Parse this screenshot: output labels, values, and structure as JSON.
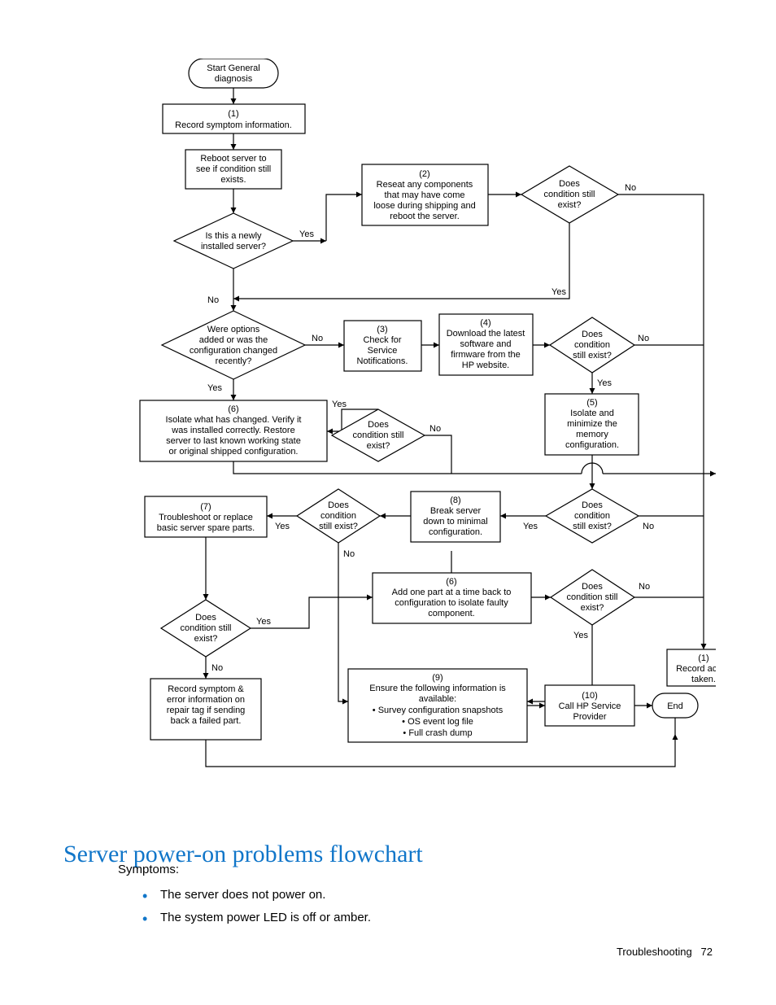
{
  "heading": "Server power-on problems flowchart",
  "body": {
    "intro": "Symptoms:",
    "bullets": [
      "The server does not power on.",
      "The system power LED is off or amber."
    ]
  },
  "footer": {
    "section": "Troubleshooting",
    "page": "72"
  },
  "flow": {
    "start": {
      "l1": "Start General",
      "l2": "diagnosis"
    },
    "n1": {
      "num": "(1)",
      "l1": "Record symptom information."
    },
    "reboot": {
      "l1": "Reboot server to",
      "l2": "see if condition still",
      "l3": "exists."
    },
    "d_newly": {
      "l1": "Is this a newly",
      "l2": "installed server?"
    },
    "n2": {
      "num": "(2)",
      "l1": "Reseat any components",
      "l2": "that may have come",
      "l3": "loose during shipping and",
      "l4": "reboot the server."
    },
    "d_cond_top": {
      "l1": "Does",
      "l2": "condition still",
      "l3": "exist?"
    },
    "d_options": {
      "l1": "Were options",
      "l2": "added or was the",
      "l3": "configuration changed",
      "l4": "recently?"
    },
    "n3": {
      "num": "(3)",
      "l1": "Check for",
      "l2": "Service",
      "l3": "Notifications."
    },
    "n4": {
      "num": "(4)",
      "l1": "Download the latest",
      "l2": "software and",
      "l3": "firmware from the",
      "l4": "HP website."
    },
    "d_cond_mid": {
      "l1": "Does",
      "l2": "condition",
      "l3": "still exist?"
    },
    "n5": {
      "num": "(5)",
      "l1": "Isolate and",
      "l2": "minimize the",
      "l3": "memory",
      "l4": "configuration."
    },
    "n6": {
      "num": "(6)",
      "l1": "Isolate what has changed. Verify it",
      "l2": "was installed correctly.  Restore",
      "l3": "server to last known working state",
      "l4": "or original shipped configuration."
    },
    "d_cond_mid2": {
      "l1": "Does",
      "l2": "condition still",
      "l3": "exist?"
    },
    "n7": {
      "num": "(7)",
      "l1": "Troubleshoot or replace",
      "l2": "basic server spare parts."
    },
    "d_cond_7": {
      "l1": "Does",
      "l2": "condition",
      "l3": "still exist?"
    },
    "n8": {
      "num": "(8)",
      "l1": "Break server",
      "l2": "down to minimal",
      "l3": "configuration."
    },
    "d_cond_8": {
      "l1": "Does",
      "l2": "condition",
      "l3": "still exist?"
    },
    "n6b": {
      "num": "(6)",
      "l1": "Add one part at a time back to",
      "l2": "configuration to isolate faulty",
      "l3": "component."
    },
    "d_cond_6b": {
      "l1": "Does",
      "l2": "condition still",
      "l3": "exist?"
    },
    "d_cond_final": {
      "l1": "Does",
      "l2": "condition still",
      "l3": "exist?"
    },
    "n1b": {
      "num": "(1)",
      "l1": "Record action",
      "l2": "taken."
    },
    "record_repair": {
      "l1": "Record symptom &",
      "l2": "error information on",
      "l3": "repair tag if sending",
      "l4": "back a failed part."
    },
    "n9": {
      "num": "(9)",
      "l1": "Ensure the following information is",
      "l2": "available:",
      "b1": "Survey configuration snapshots",
      "b2": "OS event log file",
      "b3": "Full crash dump"
    },
    "n10": {
      "num": "(10)",
      "l1": "Call HP Service",
      "l2": "Provider"
    },
    "end": "End",
    "labels": {
      "yes": "Yes",
      "no": "No"
    }
  }
}
